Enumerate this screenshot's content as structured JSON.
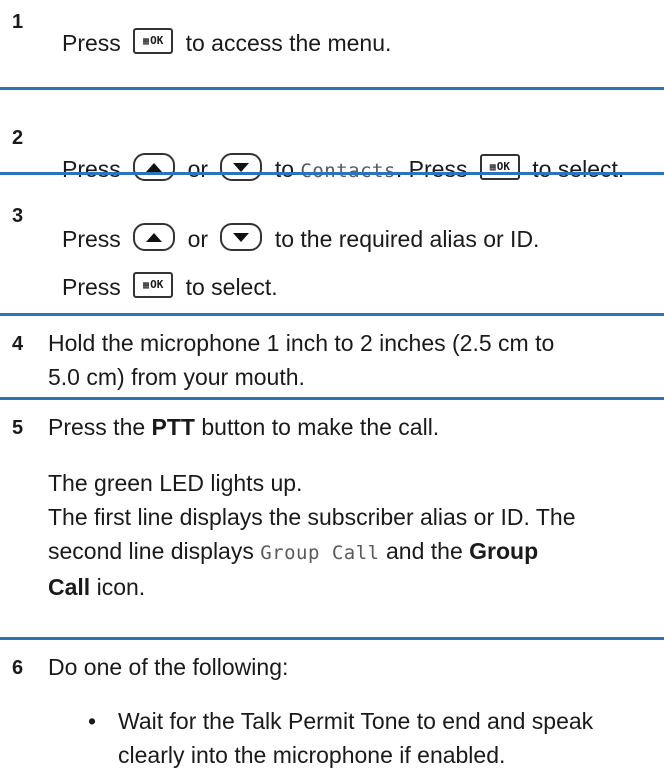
{
  "steps": [
    {
      "num": "1",
      "press": "Press",
      "ok_label": "OK",
      "after": "to access the menu."
    },
    {
      "num": "2",
      "press": "Press",
      "or": "or",
      "to": "to",
      "menu_item": "Contacts",
      "press2": ". Press",
      "ok_label": "OK",
      "after": "to select."
    },
    {
      "num": "3",
      "press": "Press",
      "or": "or",
      "after": "to the required alias or ID.",
      "press2": "Press",
      "ok_label": "OK",
      "after2": "to select."
    },
    {
      "num": "4",
      "line1": "Hold the microphone 1 inch to 2 inches (2.5 cm to",
      "line2": "5.0 cm) from your mouth."
    },
    {
      "num": "5",
      "pre": "Press the",
      "ptt": "PTT",
      "post": "button to make the call.",
      "led": "The green LED lights up.",
      "line_a": "The first line displays the subscriber alias or ID. The",
      "line_b_pre": "second line displays",
      "group_call_mono": "Group Call",
      "line_b_mid": "and the",
      "group_bold_1": "Group",
      "group_bold_2": "Call",
      "line_c_post": "icon."
    },
    {
      "num": "6",
      "text": "Do one of the following:",
      "bullet_1a": "Wait for the Talk Permit Tone to end and speak",
      "bullet_1b": "clearly into the microphone if enabled.",
      "bullet_symbol": "•"
    }
  ],
  "colors": {
    "divider": "#2b74b8",
    "text": "#1a1a1a"
  },
  "icons": {
    "ok": "menu-ok-key-icon",
    "up": "up-arrow-key-icon",
    "down": "down-arrow-key-icon"
  }
}
